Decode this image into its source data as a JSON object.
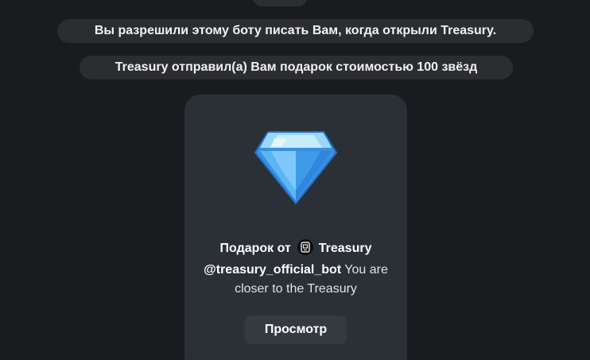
{
  "service_messages": [
    {
      "text": "Вы разрешили этому боту писать Вам, когда открыли Treasury."
    },
    {
      "text": "Treasury отправил(а) Вам подарок стоимостью 100 звёзд"
    }
  ],
  "gift": {
    "icon": "diamond-icon",
    "title_prefix": "Подарок от",
    "sender_name": "Treasury",
    "sender_icon": "bot-avatar-icon",
    "message_handle": "@treasury_official_bot",
    "message_text": " You are closer to the Treasury",
    "view_button_label": "Просмотр"
  },
  "colors": {
    "background": "#1a1b1e",
    "service_bubble": "#2b2d31",
    "card": "#2b3036",
    "button": "#353a41",
    "diamond": "#4aa8f0"
  }
}
